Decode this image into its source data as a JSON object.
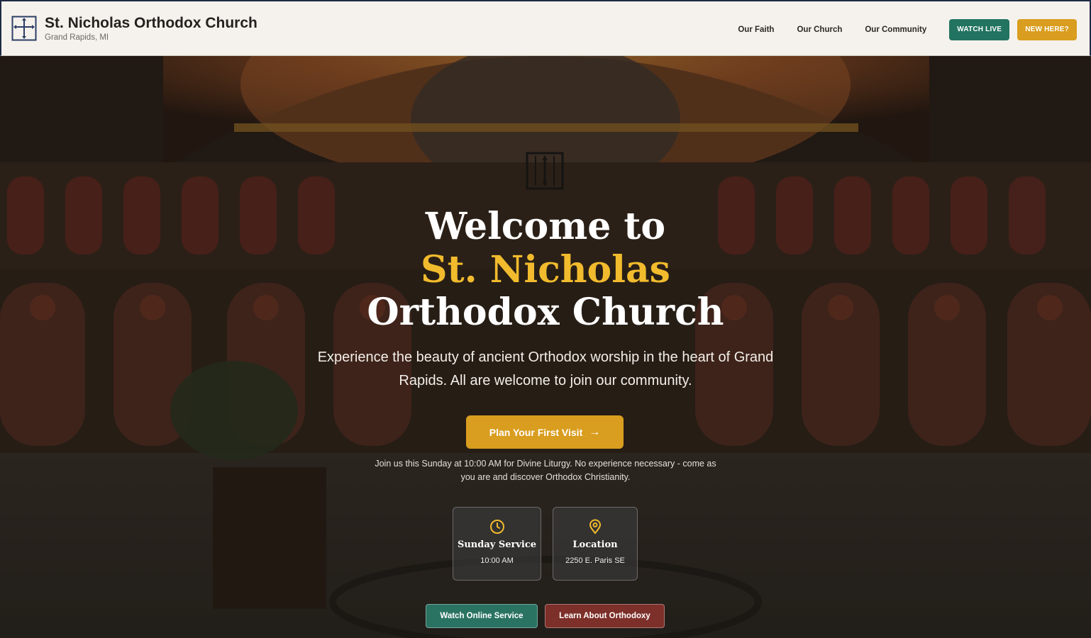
{
  "header": {
    "title": "St. Nicholas Orthodox Church",
    "subtitle": "Grand Rapids, MI",
    "nav": [
      {
        "label": "Our Faith"
      },
      {
        "label": "Our Church"
      },
      {
        "label": "Our Community"
      }
    ],
    "watch_live": "WATCH LIVE",
    "new_here": "NEW HERE?"
  },
  "hero": {
    "title_line1": "Welcome to",
    "title_line2": "St. Nicholas",
    "title_line3": "Orthodox Church",
    "subtitle": "Experience the beauty of ancient Orthodox worship in the heart of Grand Rapids. All are welcome to join our community.",
    "cta_label": "Plan Your First Visit",
    "note": "Join us this Sunday at 10:00 AM for Divine Liturgy. No experience necessary - come as you are and discover Orthodox Christianity."
  },
  "cards": [
    {
      "title": "Sunday Service",
      "value": "10:00 AM",
      "icon": "clock-icon"
    },
    {
      "title": "Location",
      "value": "2250 E. Paris SE",
      "icon": "map-pin-icon"
    }
  ],
  "buttons": {
    "watch_online": "Watch Online Service",
    "learn": "Learn About Orthodoxy"
  },
  "colors": {
    "accent_gold": "#d99d1f",
    "title_gold": "#f1bb2d",
    "green": "#227360",
    "maroon": "#7d2f29"
  }
}
